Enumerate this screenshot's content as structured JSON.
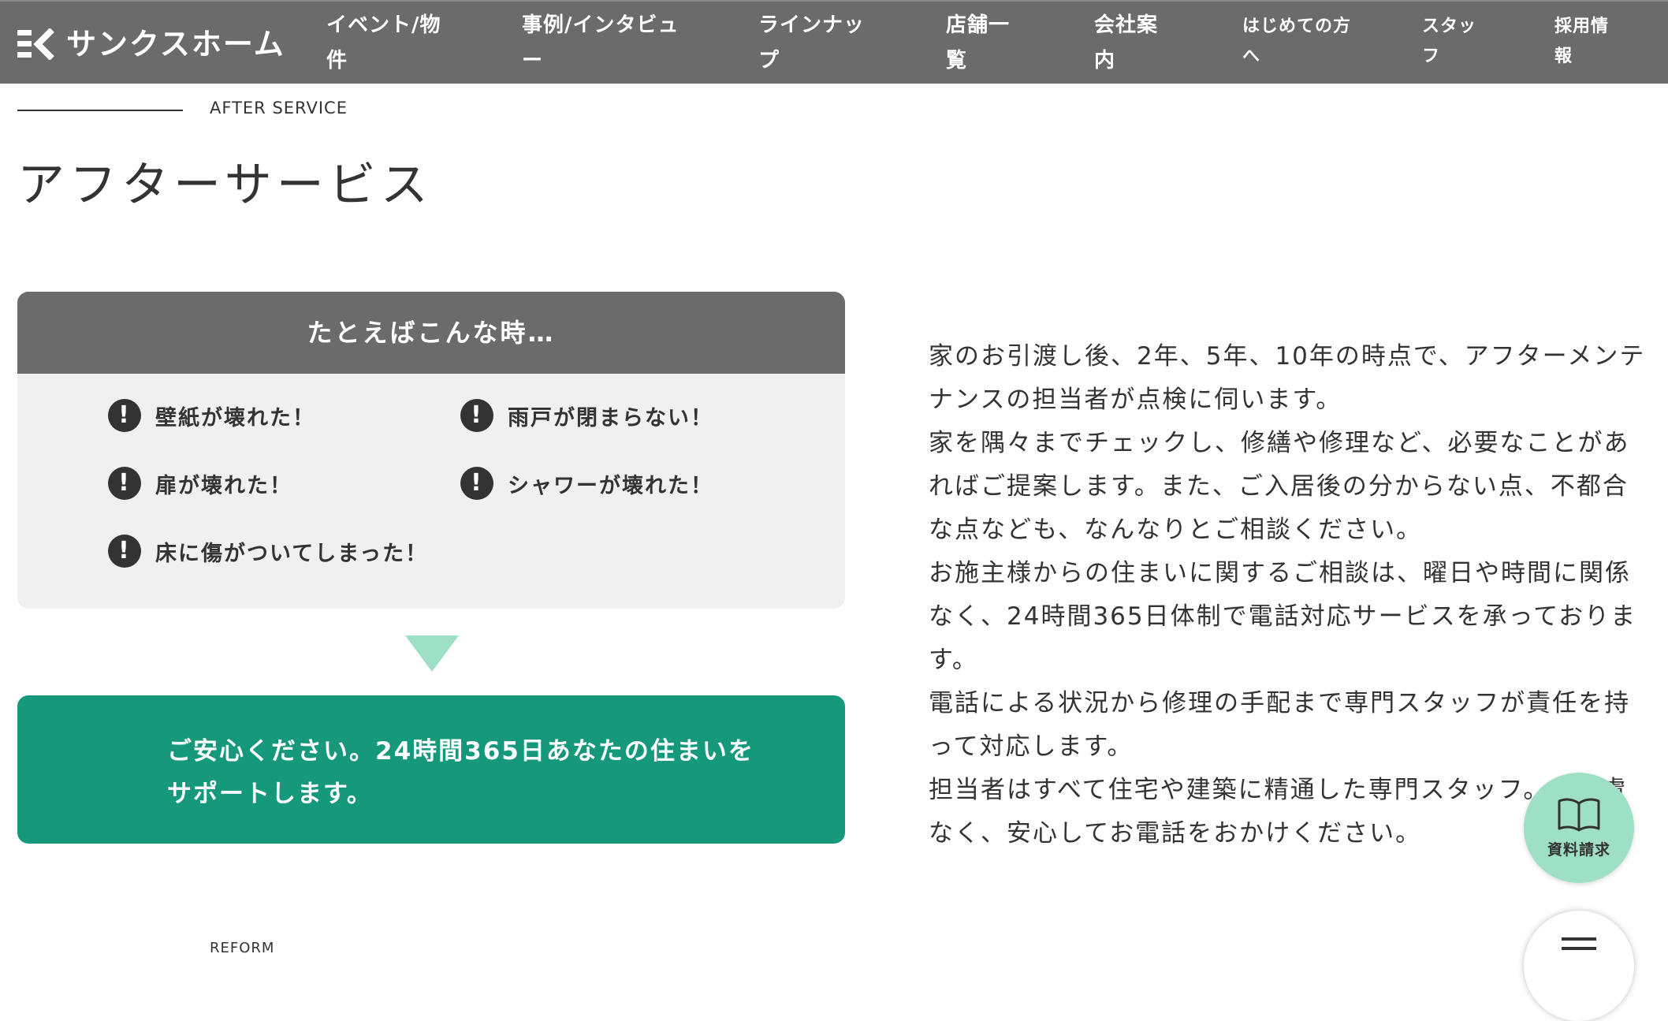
{
  "header": {
    "logo_text": "サンクスホーム",
    "nav": [
      {
        "line1": "イベント/物",
        "line2": "件"
      },
      {
        "line1": "事例/インタビュ",
        "line2": "ー"
      },
      {
        "line1": "ラインナッ",
        "line2": "プ"
      },
      {
        "line1": "店舗一",
        "line2": "覧"
      },
      {
        "line1": "会社案",
        "line2": "内"
      },
      {
        "line1": "はじめての方",
        "line2": "へ"
      },
      {
        "line1": "スタッ",
        "line2": "フ"
      },
      {
        "line1": "採用情",
        "line2": "報"
      }
    ]
  },
  "section": {
    "eyebrow": "AFTER SERVICE",
    "title": "アフターサービス"
  },
  "cases": {
    "heading": "たとえばこんな時…",
    "items": [
      "壁紙が壊れた！",
      "雨戸が閉まらない！",
      "扉が壊れた！",
      "シャワーが壊れた！",
      "床に傷がついてしまった！"
    ],
    "icon": "exclamation-icon"
  },
  "reassure": {
    "line1": "ご安心ください。24時間365日あなたの住まいを",
    "line2": "サポートします。"
  },
  "description": {
    "paragraphs": [
      "家のお引渡し後、2年、5年、10年の時点で、アフターメンテナンスの担当者が点検に伺います。",
      "家を隅々までチェックし、修繕や修理など、必要なことがあればご提案します。また、ご入居後の分からない点、不都合な点なども、なんなりとご相談ください。",
      "お施主様からの住まいに関するご相談は、曜日や時間に関係なく、24時間365日体制で電話対応サービスを承っております。",
      "電話による状況から修理の手配まで専門スタッフが責任を持って対応します。",
      "担当者はすべて住宅や建築に精通した専門スタッフ。ご遠慮なく、安心してお電話をおかけください。"
    ]
  },
  "floating": {
    "request_label": "資料請求",
    "request_icon": "book-icon",
    "menu_icon": "hamburger-menu-icon"
  },
  "next_section": {
    "eyebrow": "REFORM"
  },
  "colors": {
    "header_bg": "#6b6b6b",
    "card_bg": "#f0f0f0",
    "accent_green": "#16997a",
    "light_green": "#9ee0c6",
    "text": "#333333"
  }
}
